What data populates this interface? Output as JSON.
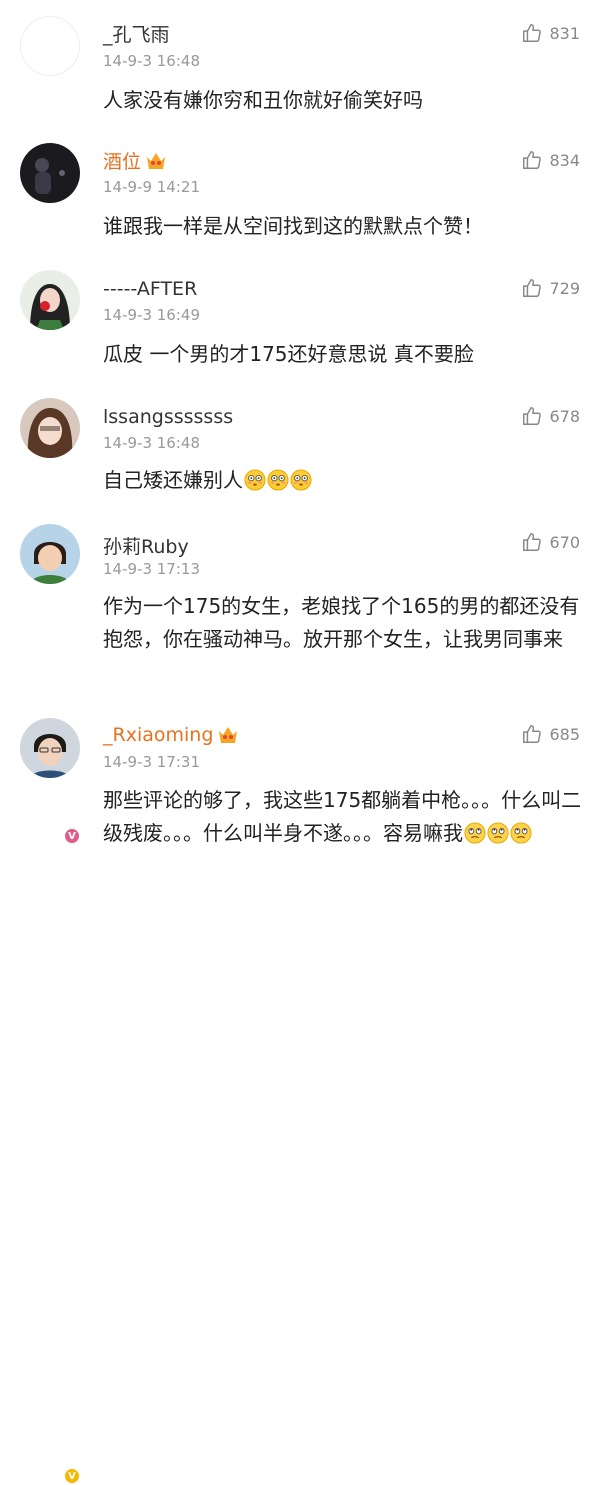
{
  "comments": [
    {
      "username": "_孔飞雨",
      "timestamp": "14-9-3 16:48",
      "likes": "831",
      "text": "人家没有嫌你穷和丑你就好偷笑好吗"
    },
    {
      "username": "酒位",
      "timestamp": "14-9-9 14:21",
      "likes": "834",
      "text": "谁跟我一样是从空间找到这的默默点个赞！"
    },
    {
      "username": "-----AFTER",
      "timestamp": "14-9-3 16:49",
      "likes": "729",
      "text": "瓜皮  一个男的才175还好意思说  真不要脸"
    },
    {
      "username": "lssangsssssss",
      "timestamp": "14-9-3 16:48",
      "likes": "678",
      "text": "自己矮还嫌别人"
    },
    {
      "username": "孙莉Ruby",
      "timestamp": "14-9-3 17:13",
      "likes": "670",
      "text": "作为一个175的女生，老娘找了个165的男的都还没有抱怨，你在骚动神马。放开那个女生，让我男同事来"
    },
    {
      "username": "_Rxiaoming",
      "timestamp": "14-9-3 17:31",
      "likes": "685",
      "text": "那些评论的够了，我这些175都躺着中枪。。。什么叫二级残废。。。什么叫半身不遂。。。容易嘛我"
    }
  ],
  "colors": {
    "vip_name": "#e8711f",
    "meta_gray": "#999999",
    "badge_pink": "#e05a8a",
    "badge_yellow": "#f5b700"
  }
}
